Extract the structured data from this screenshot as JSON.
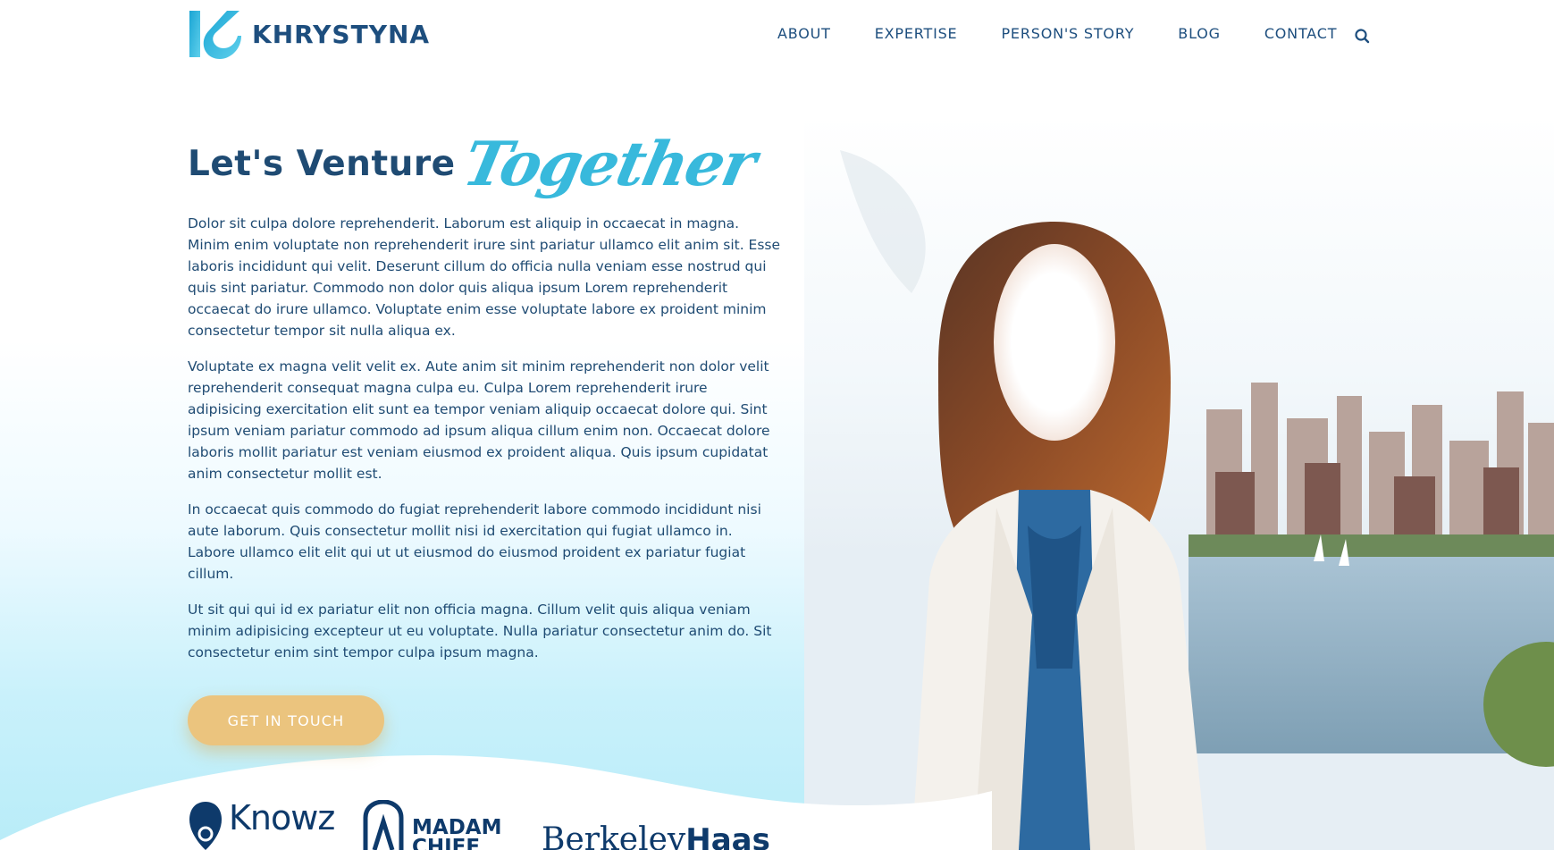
{
  "header": {
    "brand_name": "KHRYSTYNA",
    "nav": [
      {
        "label": "ABOUT"
      },
      {
        "label": "EXPERTISE"
      },
      {
        "label": "PERSON'S STORY"
      },
      {
        "label": "BLOG"
      },
      {
        "label": "CONTACT"
      }
    ],
    "search_icon": "search-icon"
  },
  "hero": {
    "title_main": "Let's Venture",
    "title_script": "Together",
    "paragraphs": [
      "Dolor sit culpa dolore reprehenderit. Laborum est aliquip in occaecat in magna. Minim enim voluptate non reprehenderit irure sint pariatur ullamco elit anim sit. Esse laboris incididunt qui velit. Deserunt cillum do officia nulla veniam esse nostrud qui quis sint pariatur. Commodo non dolor quis aliqua ipsum Lorem reprehenderit occaecat do irure ullamco. Voluptate enim esse voluptate labore ex proident minim consectetur tempor sit nulla aliqua ex.",
      "Voluptate ex magna velit velit ex. Aute anim sit minim reprehenderit non dolor velit reprehenderit consequat magna culpa eu. Culpa Lorem reprehenderit irure adipisicing exercitation elit sunt ea tempor veniam aliquip occaecat dolore qui. Sint ipsum veniam pariatur commodo ad ipsum aliqua cillum enim non. Occaecat dolore laboris mollit pariatur est veniam eiusmod ex proident aliqua. Quis ipsum cupidatat anim consectetur mollit est.",
      "In occaecat quis commodo do fugiat reprehenderit labore commodo incididunt nisi aute laborum. Quis consectetur mollit nisi id exercitation qui fugiat ullamco in. Labore ullamco elit elit qui ut ut eiusmod do eiusmod proident ex pariatur fugiat cillum.",
      "Ut sit qui qui id ex pariatur elit non officia magna. Cillum velit quis aliqua veniam minim adipisicing excepteur ut eu voluptate. Nulla pariatur consectetur anim do. Sit consectetur enim sint tempor culpa ipsum magna."
    ],
    "cta_label": "GET IN TOUCH"
  },
  "partners": {
    "knowz": "Knowz",
    "madam_line1": "MADAM",
    "madam_line2": "CHIEF",
    "haas_part1": "Berkeley",
    "haas_part2": "Haas"
  },
  "colors": {
    "brand_navy": "#1d4e7e",
    "accent_cyan": "#38b9dc",
    "cta_gold": "#ebc47e"
  }
}
